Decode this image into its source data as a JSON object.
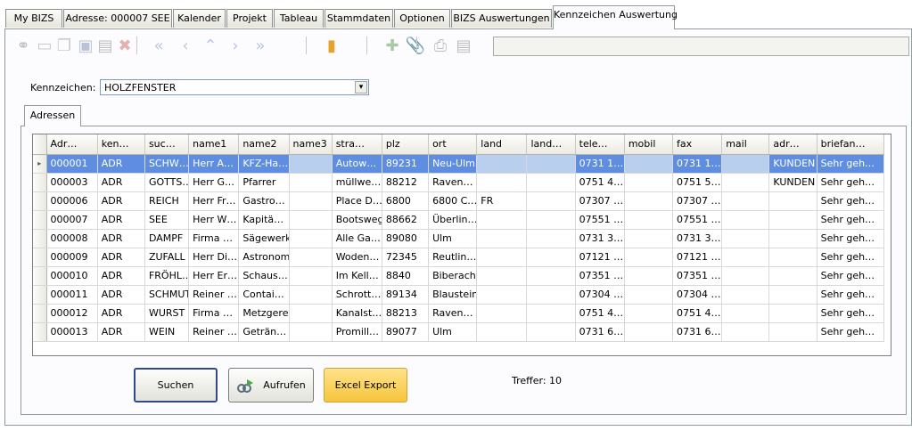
{
  "tabs": [
    "My BIZS",
    "Adresse: 000007 SEE",
    "Kalender",
    "Projekt",
    "Tableau",
    "Stammdaten",
    "Optionen",
    "BIZS Auswertungen",
    "Kennzeichen Auswertung"
  ],
  "active_tab": "Kennzeichen Auswertung",
  "toolbar_icons": [
    "link-icon",
    "new-document-icon",
    "copy-document-icon",
    "save-icon",
    "save-as-icon",
    "delete-icon",
    "first-record-icon",
    "previous-record-icon",
    "up-record-icon",
    "next-record-icon",
    "last-record-icon",
    "exit-door-icon",
    "add-link-icon",
    "attachment-icon",
    "print-icon",
    "print-preview-icon"
  ],
  "filter": {
    "label": "Kennzeichen:",
    "value": "HOLZFENSTER"
  },
  "subtab": "Adressen",
  "table": {
    "columns": [
      "Adr…",
      "ken…",
      "suc…",
      "name1",
      "name2",
      "name3",
      "stra…",
      "plz",
      "ort",
      "land",
      "land…",
      "tele…",
      "mobil",
      "fax",
      "mail",
      "adr…",
      "briefan…"
    ],
    "rows": [
      [
        "000001",
        "ADR",
        "SCHW…",
        "Herr A…",
        "KFZ-Ha…",
        "",
        "Autow…",
        "89231",
        "Neu-Ulm",
        "",
        "",
        "0731 1…",
        "",
        "0731 1…",
        "",
        "KUNDEN",
        "Sehr geh…"
      ],
      [
        "000003",
        "ADR",
        "GOTTS…",
        "Herr G…",
        "Pfarrer",
        "",
        "müllwe…",
        "88212",
        "Raven…",
        "",
        "",
        "0751 4…",
        "",
        "0751 5…",
        "",
        "KUNDEN",
        "Sehr geh…"
      ],
      [
        "000006",
        "ADR",
        "REICH",
        "Herr Fr…",
        "Gastro…",
        "",
        "Place D…",
        "6800",
        "6800 C…",
        "FR",
        "",
        "07307 …",
        "",
        "07307 …",
        "",
        "",
        "Sehr geh…"
      ],
      [
        "000007",
        "ADR",
        "SEE",
        "Herr W…",
        "Kapitä…",
        "",
        "Bootsweg",
        "88662",
        "Überlin…",
        "",
        "",
        "07551 …",
        "",
        "07551 …",
        "",
        "",
        "Sehr geh…"
      ],
      [
        "000008",
        "ADR",
        "DAMPF",
        "Firma …",
        "Sägewerk",
        "",
        "Alle Ga…",
        "89080",
        "Ulm",
        "",
        "",
        "0731 3…",
        "",
        "0731 3…",
        "",
        "",
        "Sehr geh…"
      ],
      [
        "000009",
        "ADR",
        "ZUFALL",
        "Herr Di…",
        "Astronom",
        "",
        "Woden…",
        "72345",
        "Reutlin…",
        "",
        "",
        "07121 …",
        "",
        "07121 …",
        "",
        "",
        "Sehr geh…"
      ],
      [
        "000010",
        "ADR",
        "FRÖHL…",
        "Herr Er…",
        "Schaus…",
        "",
        "Im Kell…",
        "8840",
        "Biberach",
        "",
        "",
        "07351 …",
        "",
        "07351 …",
        "",
        "",
        "Sehr geh…"
      ],
      [
        "000011",
        "ADR",
        "SCHMUTZ",
        "Reiner …",
        "Contai…",
        "",
        "Schrott…",
        "89134",
        "Blaustein",
        "",
        "",
        "07304 …",
        "",
        "07304 …",
        "",
        "",
        "Sehr geh…"
      ],
      [
        "000012",
        "ADR",
        "WURST",
        "Firma …",
        "Metzgerei",
        "",
        "Kanalst…",
        "88213",
        "Raven…",
        "",
        "",
        "0751 4…",
        "",
        "0751 4…",
        "",
        "",
        "Sehr geh…"
      ],
      [
        "000013",
        "ADR",
        "WEIN",
        "Reiner …",
        "Geträn…",
        "",
        "Promill…",
        "89077",
        "Ulm",
        "",
        "",
        "0731 6…",
        "",
        "0731 6…",
        "",
        "",
        "Sehr geh…"
      ]
    ],
    "selected_row": 0
  },
  "buttons": {
    "search": "Suchen",
    "open": "Aufrufen",
    "excel": "Excel Export"
  },
  "treffer": "Treffer: 10",
  "colors": {
    "selection": "#5f8de0",
    "selection_light": "#b9cfee",
    "excel_button": "#f6c53b"
  }
}
